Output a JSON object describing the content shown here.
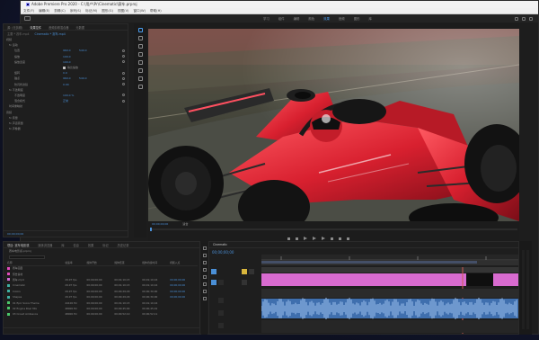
{
  "app": {
    "title": "Adobe Premiere Pro 2020 - C:\\用户\\Pr\\Cinematic\\赛车.prproj",
    "menu": [
      "文件(F)",
      "编辑(E)",
      "剪辑(C)",
      "序列(S)",
      "标记(M)",
      "图形(G)",
      "视图(V)",
      "窗口(W)",
      "帮助(H)"
    ],
    "workspaces": [
      "学习",
      "组件",
      "编辑",
      "颜色",
      "效果",
      "音频",
      "图形",
      "库"
    ],
    "active_workspace": "效果"
  },
  "effect_controls": {
    "tabs": [
      "源: (无剪辑)",
      "效果控件",
      "音频剪辑混合器",
      "元数据"
    ],
    "active_tab": "效果控件",
    "source": "主要 * 赛车.mp4",
    "sequence": "Cinematic * 赛车.mp4",
    "rows": [
      {
        "label": "视频",
        "v1": "",
        "v2": ""
      },
      {
        "label": "fx 运动",
        "v1": "",
        "v2": ""
      },
      {
        "label": "位置",
        "v1": "960.0",
        "v2": "540.0"
      },
      {
        "label": "缩放",
        "v1": "100.0",
        "v2": ""
      },
      {
        "label": "缩放宽度",
        "v1": "100.0",
        "v2": ""
      },
      {
        "label": "",
        "v1": "等比缩放",
        "v2": ""
      },
      {
        "label": "旋转",
        "v1": "0.0",
        "v2": ""
      },
      {
        "label": "锚点",
        "v1": "960.0",
        "v2": "540.0"
      },
      {
        "label": "防闪烁滤镜",
        "v1": "0.00",
        "v2": ""
      },
      {
        "label": "fx 不透明度",
        "v1": "",
        "v2": ""
      },
      {
        "label": "不透明度",
        "v1": "100.0 %",
        "v2": ""
      },
      {
        "label": "混合模式",
        "v1": "正常",
        "v2": ""
      },
      {
        "label": "时间重映射",
        "v1": "",
        "v2": ""
      },
      {
        "label": "音频",
        "v1": "",
        "v2": ""
      },
      {
        "label": "fx 音量",
        "v1": "",
        "v2": ""
      },
      {
        "label": "fx 声道音量",
        "v1": "",
        "v2": ""
      },
      {
        "label": "fx 声像器",
        "v1": "",
        "v2": ""
      }
    ],
    "timecode": "00;00;00;00"
  },
  "program_monitor": {
    "timecode": "00;00;00;00",
    "fit": "适合",
    "duration": "00;01;10;16",
    "quality": "完整"
  },
  "project": {
    "tabs": [
      "项目: 赛车电影感",
      "媒体浏览器",
      "库",
      "信息",
      "效果",
      "标记",
      "历史记录"
    ],
    "active_tab": "项目: 赛车电影感",
    "path": "赛车电影感.prproj",
    "item_count": "9 个项",
    "columns": [
      "名称",
      "帧速率",
      "媒体开始",
      "媒体结束",
      "媒体持续时间",
      "视频入点"
    ],
    "items": [
      {
        "name": "赛车画面",
        "color": "#e14bbd",
        "fps": "",
        "start": "",
        "end": "",
        "dur": "",
        "in": ""
      },
      {
        "name": "预告素材",
        "color": "#e14bbd",
        "fps": "",
        "start": "",
        "end": "",
        "dur": "",
        "in": ""
      },
      {
        "name": "赛车.mp4",
        "color": "#d56ad9",
        "fps": "29.97 fps",
        "start": "00;00;00;00",
        "end": "00;01;10;15",
        "dur": "00;01;10;16",
        "in": "00;00;00;00"
      },
      {
        "name": "Cinematic",
        "color": "#3fb0a3",
        "fps": "29.97 fps",
        "start": "00;00;00;00",
        "end": "00;01;10;15",
        "dur": "00;01;10;16",
        "in": "00;00;00;00"
      },
      {
        "name": "Colors",
        "color": "#3fb0a3",
        "fps": "29.97 fps",
        "start": "00;00;00;00",
        "end": "00;00;29;29",
        "dur": "00;00;30;00",
        "in": "00;00;00;00"
      },
      {
        "name": "Shapes",
        "color": "#3fb0a3",
        "fps": "29.97 fps",
        "start": "00;00;00;00",
        "end": "00;00;29;29",
        "dur": "00;00;30;00",
        "in": "00;00;00;00"
      },
      {
        "name": "01 Epic Score Theme",
        "color": "#4bc76a",
        "fps": "44100 Hz",
        "start": "00;00;00;00",
        "end": "00;01;10;15",
        "dur": "00;01;10;16",
        "in": ""
      },
      {
        "name": "02 Engine Roar Mix",
        "color": "#4bc76a",
        "fps": "48000 Hz",
        "start": "00;00;00;00",
        "end": "00;00;45;00",
        "dur": "00;00;45;01",
        "in": ""
      },
      {
        "name": "03 Crowd Ambience",
        "color": "#4bc76a",
        "fps": "48000 Hz",
        "start": "00;00;00;00",
        "end": "00;00;52;10",
        "dur": "00;00;52;11",
        "in": ""
      }
    ]
  },
  "timeline": {
    "tab": "Cinematic",
    "timecode": "00;00;00;00",
    "ruler": [
      "00;00",
      "00;00;14;29",
      "00;00;29;29",
      "00;00;44;28",
      "00;00;59;28"
    ],
    "tracks": [
      "V3",
      "V2",
      "V1",
      "A1",
      "A2",
      "A3"
    ]
  },
  "colors": {
    "accent": "#4a8fd6",
    "video_clip": "#d96bd0",
    "audio_clip": "#3f6fae",
    "label_yellow": "#d9b63c"
  }
}
